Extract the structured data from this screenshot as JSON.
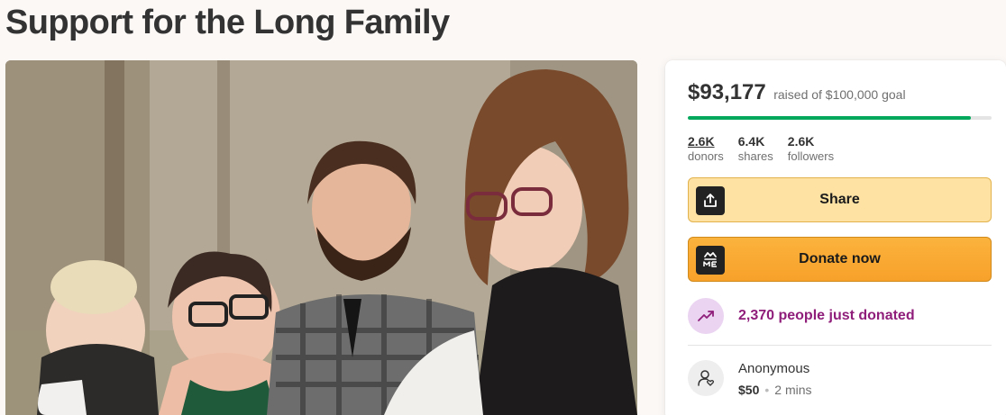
{
  "page": {
    "title": "Support for the Long Family"
  },
  "campaign": {
    "amount_raised": "$93,177",
    "goal_text": "raised of $100,000 goal",
    "progress_fraction": 0.93177,
    "stats": [
      {
        "value": "2.6K",
        "label": "donors"
      },
      {
        "value": "6.4K",
        "label": "shares"
      },
      {
        "value": "2.6K",
        "label": "followers"
      }
    ],
    "share_label": "Share",
    "donate_label": "Donate now",
    "recent_text": "2,370 people just donated",
    "recent_donation": {
      "name": "Anonymous",
      "amount": "$50",
      "time": "2 mins"
    }
  },
  "icons": {
    "share": "share-upload-icon",
    "donate": "gofundme-logo-icon",
    "trend": "trending-up-icon",
    "donor": "user-heart-icon"
  },
  "colors": {
    "progress": "#02a95c",
    "share_button": "#fde2a4",
    "donate_button": "#f7a12a",
    "recent_accent": "#8f1d7a",
    "recent_badge": "#ead4f1"
  }
}
